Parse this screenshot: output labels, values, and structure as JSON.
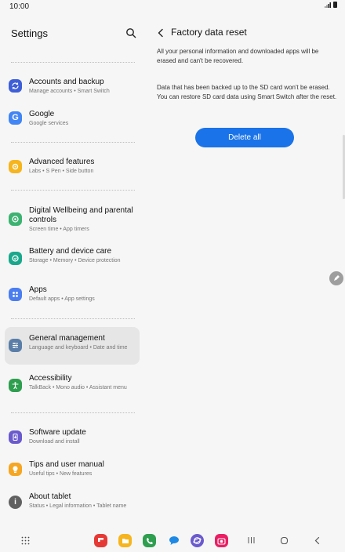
{
  "status_bar": {
    "time": "10:00"
  },
  "settings": {
    "title": "Settings",
    "items": [
      {
        "title": "Accounts and backup",
        "subtitle": "Manage accounts • Smart Switch",
        "icon": "sync-icon",
        "color": "#3f5fd8"
      },
      {
        "title": "Google",
        "subtitle": "Google services",
        "icon": "google-icon",
        "color": "#4285f4"
      },
      {
        "title": "Advanced features",
        "subtitle": "Labs • S Pen • Side button",
        "icon": "gear-plus-icon",
        "color": "#f6b51e"
      },
      {
        "title": "Digital Wellbeing and parental controls",
        "subtitle": "Screen time • App timers",
        "icon": "wellbeing-icon",
        "color": "#3cb371"
      },
      {
        "title": "Battery and device care",
        "subtitle": "Storage • Memory • Device protection",
        "icon": "device-care-icon",
        "color": "#1aa88c"
      },
      {
        "title": "Apps",
        "subtitle": "Default apps • App settings",
        "icon": "apps-icon",
        "color": "#4a7df0"
      },
      {
        "title": "General management",
        "subtitle": "Language and keyboard • Date and time",
        "icon": "sliders-icon",
        "color": "#5a7ea8"
      },
      {
        "title": "Accessibility",
        "subtitle": "TalkBack • Mono audio • Assistant menu",
        "icon": "accessibility-icon",
        "color": "#2e9e4f"
      },
      {
        "title": "Software update",
        "subtitle": "Download and install",
        "icon": "software-update-icon",
        "color": "#6a5acd"
      },
      {
        "title": "Tips and user manual",
        "subtitle": "Useful tips • New features",
        "icon": "tips-icon",
        "color": "#f5a623"
      },
      {
        "title": "About tablet",
        "subtitle": "Status • Legal information • Tablet name",
        "icon": "info-icon",
        "color": "#616161"
      }
    ],
    "selected_index": 6
  },
  "detail": {
    "title": "Factory data reset",
    "paragraph_1": "All your personal information and downloaded apps will be erased and can't be recovered.",
    "paragraph_2": "Data that has been backed up to the SD card won't be erased. You can restore SD card data using Smart Switch after the reset.",
    "delete_button": "Delete all",
    "accent_color": "#1a73e8"
  },
  "navigation_bar": {
    "apps": [
      {
        "icon": "flipboard-icon",
        "color": "#e53935"
      },
      {
        "icon": "my-files-icon",
        "color": "#f6b51e"
      },
      {
        "icon": "phone-icon",
        "color": "#2e9e4f"
      },
      {
        "icon": "messages-icon",
        "color": "#1e88e5"
      },
      {
        "icon": "internet-icon",
        "color": "#6a5acd"
      },
      {
        "icon": "camera-icon",
        "color": "#e91e63"
      }
    ],
    "buttons": [
      "app-drawer-icon",
      "recents-icon",
      "home-icon",
      "back-icon"
    ]
  }
}
